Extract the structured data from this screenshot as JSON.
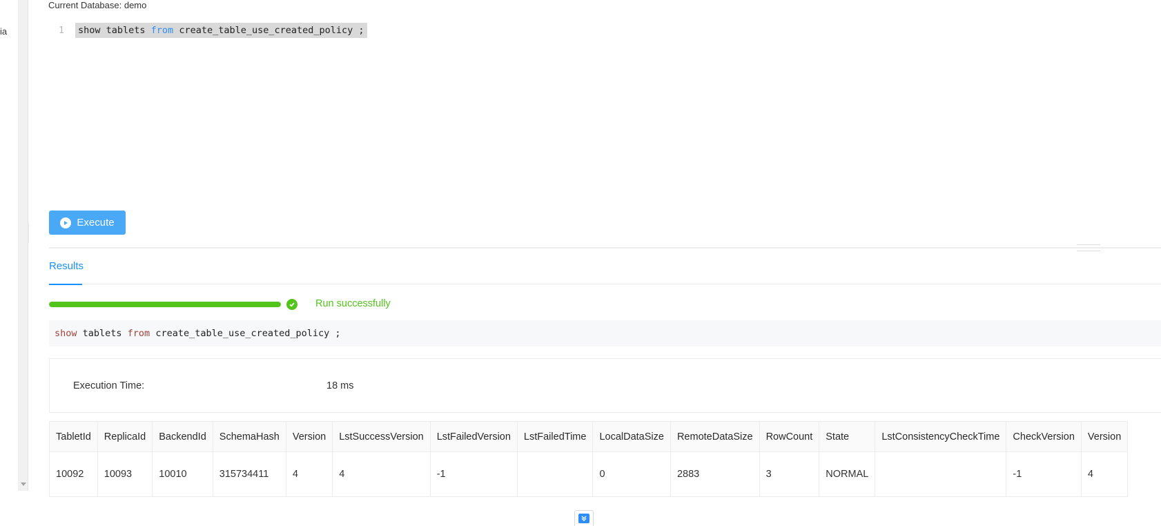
{
  "sidebar": {
    "cut_text": "ia"
  },
  "header": {
    "current_database": "Current Database: demo"
  },
  "editor": {
    "line_number": "1",
    "code_part1": "show tablets ",
    "code_keyword": "from",
    "code_part2": " create_table_use_created_policy ;"
  },
  "toolbar": {
    "execute_label": "Execute"
  },
  "tabs": {
    "results_label": "Results"
  },
  "run_status": {
    "text": "Run successfully",
    "progress": 1.0,
    "color": "#52c41a"
  },
  "executed_sql": {
    "kw1": "show",
    "part1": " tablets ",
    "kw2": "from",
    "part2": " create_table_use_created_policy ;"
  },
  "execution": {
    "label": "Execution Time:",
    "value": "18 ms"
  },
  "results_table": {
    "columns": [
      "TabletId",
      "ReplicaId",
      "BackendId",
      "SchemaHash",
      "Version",
      "LstSuccessVersion",
      "LstFailedVersion",
      "LstFailedTime",
      "LocalDataSize",
      "RemoteDataSize",
      "RowCount",
      "State",
      "LstConsistencyCheckTime",
      "CheckVersion",
      "Version"
    ],
    "rows": [
      [
        "10092",
        "10093",
        "10010",
        "315734411",
        "4",
        "4",
        "-1",
        "",
        "0",
        "2883",
        "3",
        "NORMAL",
        "",
        "-1",
        "4"
      ]
    ]
  },
  "colors": {
    "accent": "#1890ff",
    "execute_button": "#4aa9f6",
    "success": "#52c41a",
    "keyword_blue": "#2f8ef6",
    "keyword_red": "#a0453a"
  },
  "icons": {
    "execute": "play-circle-icon",
    "status": "check-circle-icon",
    "bottom": "scroll-down-icon"
  }
}
